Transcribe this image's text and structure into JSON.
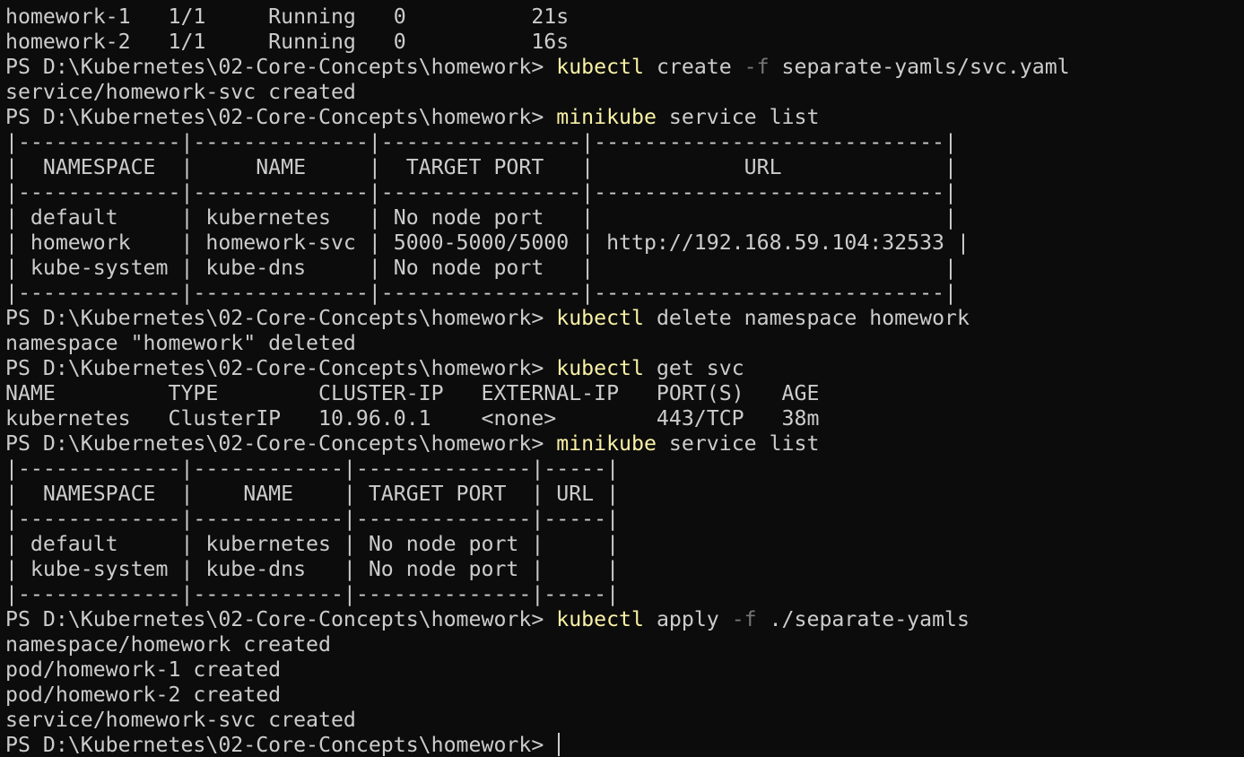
{
  "terminal": {
    "lines": [
      {
        "type": "output",
        "text": "homework-1   1/1     Running   0          21s"
      },
      {
        "type": "output",
        "text": "homework-2   1/1     Running   0          16s"
      },
      {
        "type": "prompt",
        "prompt": "PS D:\\Kubernetes\\02-Core-Concepts\\homework> ",
        "cmd": "kubectl",
        "args": [
          {
            "text": " create "
          },
          {
            "text": "-f",
            "flag": true
          },
          {
            "text": " separate-yamls/svc.yaml"
          }
        ]
      },
      {
        "type": "output",
        "text": "service/homework-svc created"
      },
      {
        "type": "prompt",
        "prompt": "PS D:\\Kubernetes\\02-Core-Concepts\\homework> ",
        "cmd": "minikube",
        "args": [
          {
            "text": " service list"
          }
        ]
      },
      {
        "type": "output",
        "text": "|-------------|--------------|----------------|----------------------------|"
      },
      {
        "type": "output",
        "text": "|  NAMESPACE  |     NAME     |  TARGET PORT   |            URL             |"
      },
      {
        "type": "output",
        "text": "|-------------|--------------|----------------|----------------------------|"
      },
      {
        "type": "output",
        "text": "| default     | kubernetes   | No node port   |                            |"
      },
      {
        "type": "output",
        "text": "| homework    | homework-svc | 5000-5000/5000 | http://192.168.59.104:32533 |"
      },
      {
        "type": "output",
        "text": "| kube-system | kube-dns     | No node port   |                            |"
      },
      {
        "type": "output",
        "text": "|-------------|--------------|----------------|----------------------------|"
      },
      {
        "type": "prompt",
        "prompt": "PS D:\\Kubernetes\\02-Core-Concepts\\homework> ",
        "cmd": "kubectl",
        "args": [
          {
            "text": " delete namespace homework"
          }
        ]
      },
      {
        "type": "output",
        "text": "namespace \"homework\" deleted"
      },
      {
        "type": "prompt",
        "prompt": "PS D:\\Kubernetes\\02-Core-Concepts\\homework> ",
        "cmd": "kubectl",
        "args": [
          {
            "text": " get svc"
          }
        ]
      },
      {
        "type": "output",
        "text": "NAME         TYPE        CLUSTER-IP   EXTERNAL-IP   PORT(S)   AGE"
      },
      {
        "type": "output",
        "text": "kubernetes   ClusterIP   10.96.0.1    <none>        443/TCP   38m"
      },
      {
        "type": "prompt",
        "prompt": "PS D:\\Kubernetes\\02-Core-Concepts\\homework> ",
        "cmd": "minikube",
        "args": [
          {
            "text": " service list"
          }
        ]
      },
      {
        "type": "output",
        "text": "|-------------|------------|--------------|-----|"
      },
      {
        "type": "output",
        "text": "|  NAMESPACE  |    NAME    | TARGET PORT  | URL |"
      },
      {
        "type": "output",
        "text": "|-------------|------------|--------------|-----|"
      },
      {
        "type": "output",
        "text": "| default     | kubernetes | No node port |     |"
      },
      {
        "type": "output",
        "text": "| kube-system | kube-dns   | No node port |     |"
      },
      {
        "type": "output",
        "text": "|-------------|------------|--------------|-----|"
      },
      {
        "type": "prompt",
        "prompt": "PS D:\\Kubernetes\\02-Core-Concepts\\homework> ",
        "cmd": "kubectl",
        "args": [
          {
            "text": " apply "
          },
          {
            "text": "-f",
            "flag": true
          },
          {
            "text": " ./separate-yamls"
          }
        ]
      },
      {
        "type": "output",
        "text": "namespace/homework created"
      },
      {
        "type": "output",
        "text": "pod/homework-1 created"
      },
      {
        "type": "output",
        "text": "pod/homework-2 created"
      },
      {
        "type": "output",
        "text": "service/homework-svc created"
      },
      {
        "type": "prompt",
        "prompt": "PS D:\\Kubernetes\\02-Core-Concepts\\homework> ",
        "cmd": "",
        "args": [],
        "cursor": true
      }
    ]
  },
  "colors": {
    "background": "#0c0c0c",
    "text": "#cccccc",
    "command": "#f9f1a5",
    "flag": "#767676"
  }
}
